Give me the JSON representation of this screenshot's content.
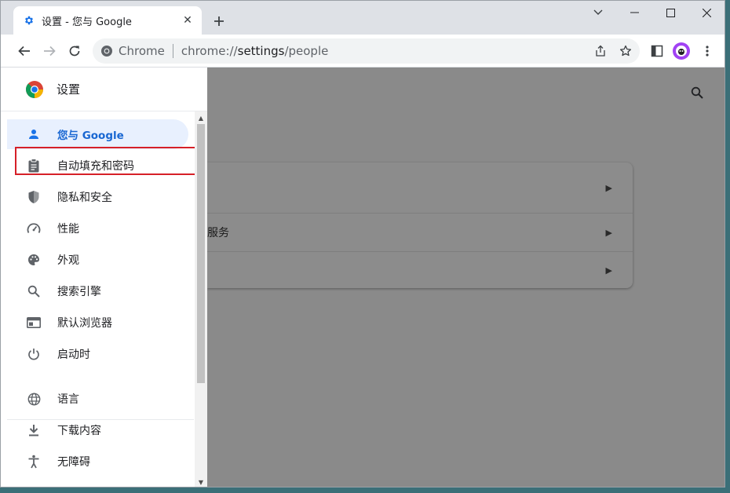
{
  "tab": {
    "title": "设置 - 您与 Google",
    "close_symbol": "✕"
  },
  "toolbar": {
    "chip_label": "Chrome",
    "url_scheme": "chrome://",
    "url_host": "settings",
    "url_path": "/people"
  },
  "drawer": {
    "title": "设置",
    "items": [
      {
        "label": "您与 Google",
        "icon": "person-icon",
        "active": true
      },
      {
        "label": "自动填充和密码",
        "icon": "clipboard-icon",
        "active": false
      },
      {
        "label": "隐私和安全",
        "icon": "shield-icon",
        "active": false
      },
      {
        "label": "性能",
        "icon": "speedometer-icon",
        "active": false
      },
      {
        "label": "外观",
        "icon": "palette-icon",
        "active": false
      },
      {
        "label": "搜索引擎",
        "icon": "search-icon",
        "active": false
      },
      {
        "label": "默认浏览器",
        "icon": "browser-icon",
        "active": false
      },
      {
        "label": "启动时",
        "icon": "power-icon",
        "active": false
      },
      {
        "label": "语言",
        "icon": "globe-icon",
        "active": false
      },
      {
        "label": "下载内容",
        "icon": "download-icon",
        "active": false
      },
      {
        "label": "无障碍",
        "icon": "accessibility-icon",
        "active": false
      }
    ]
  },
  "main": {
    "card_rows": [
      {
        "text": ""
      },
      {
        "text": "服务"
      },
      {
        "text": ""
      }
    ],
    "arrow_symbol": "▶"
  },
  "colors": {
    "accent": "#1a73e8",
    "active_bg": "#e8f0fe",
    "highlight": "#d62028",
    "overlay": "#8a8a8a"
  }
}
